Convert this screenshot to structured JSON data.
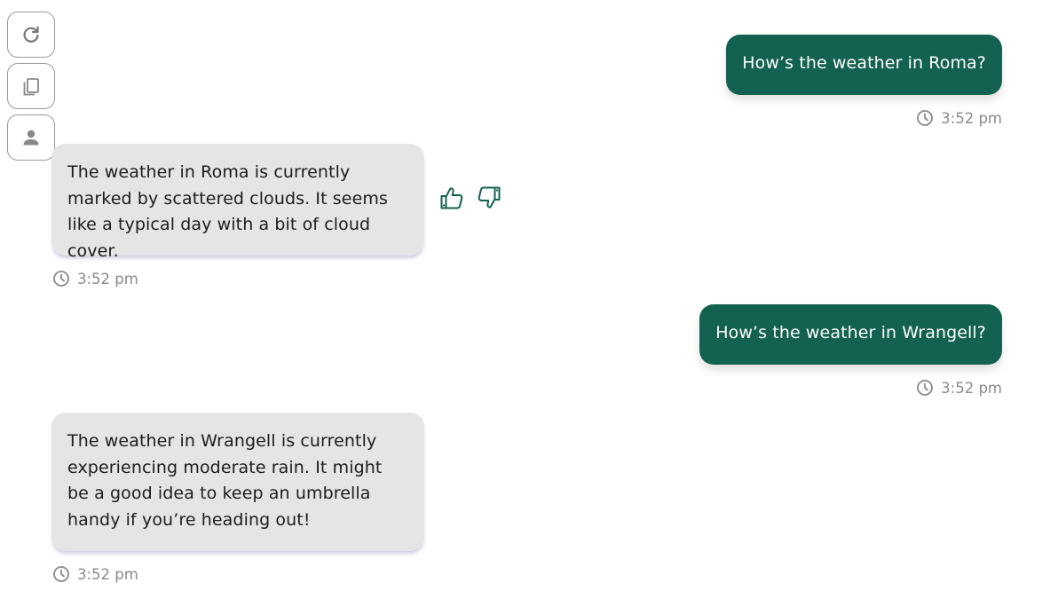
{
  "side_actions": [
    {
      "name": "refresh",
      "icon": "refresh-icon"
    },
    {
      "name": "copy",
      "icon": "copy-icon"
    },
    {
      "name": "user",
      "icon": "person-icon"
    }
  ],
  "messages": [
    {
      "role": "user",
      "text": "How’s the weather in Roma?",
      "time": "3:52 pm"
    },
    {
      "role": "assistant",
      "text": "The weather in Roma is currently marked by scattered clouds. It seems like a typical day with a bit of cloud cover.",
      "time": "3:52 pm"
    },
    {
      "role": "user",
      "text": "How’s the weather in Wrangell?",
      "time": "3:52 pm"
    },
    {
      "role": "assistant",
      "text": "The weather in Wrangell is currently experiencing moderate rain. It might be a good idea to keep an umbrella handy if you’re heading out!",
      "time": "3:52 pm"
    }
  ],
  "feedback": {
    "icons": [
      "thumbs-up-icon",
      "thumbs-down-icon"
    ]
  },
  "colors": {
    "user_bubble": "#136150",
    "assistant_bubble": "#e5e5e5",
    "timestamp": "#8a8a8a",
    "accent": "#136150"
  }
}
